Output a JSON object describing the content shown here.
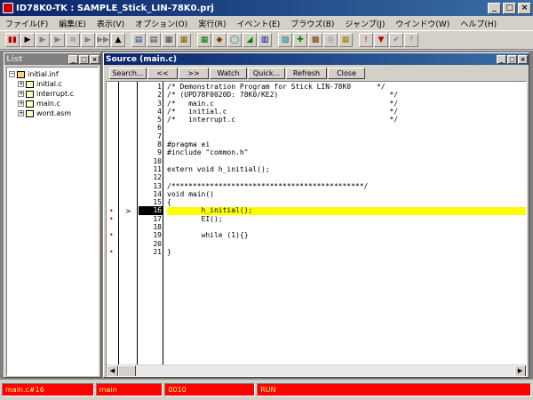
{
  "window": {
    "title": "ID78K0-TK : SAMPLE_Stick_LIN-78K0.prj"
  },
  "menu": [
    "ファイル(F)",
    "編集(E)",
    "表示(V)",
    "オプション(O)",
    "実行(R)",
    "イベント(E)",
    "ブラウズ(B)",
    "ジャンプ(J)",
    "ウインドウ(W)",
    "ヘルプ(H)"
  ],
  "toolbar_icons": [
    {
      "name": "stop-icon",
      "glyph": "▮▮",
      "color": "#c00000"
    },
    {
      "name": "run-icon",
      "glyph": "▶",
      "color": "#000"
    },
    {
      "name": "go-icon",
      "glyph": "▶",
      "color": "#808080"
    },
    {
      "name": "go-restart-icon",
      "glyph": "▶",
      "color": "#808080"
    },
    {
      "name": "step-in-icon",
      "glyph": "≡",
      "color": "#808080"
    },
    {
      "name": "step-over-icon",
      "glyph": "▶",
      "color": "#808080"
    },
    {
      "name": "return-icon",
      "glyph": "▶▶",
      "color": "#808080"
    },
    {
      "name": "eject-icon",
      "glyph": "▲",
      "color": "#000"
    },
    {
      "name": "source-icon",
      "glyph": "▤",
      "color": "#204080"
    },
    {
      "name": "assemble-icon",
      "glyph": "▤",
      "color": "#404040"
    },
    {
      "name": "memory-icon",
      "glyph": "▦",
      "color": "#404040"
    },
    {
      "name": "register-icon",
      "glyph": "▦",
      "color": "#806000"
    },
    {
      "name": "sfr-icon",
      "glyph": "▦",
      "color": "#008000"
    },
    {
      "name": "local-var-icon",
      "glyph": "◆",
      "color": "#804000"
    },
    {
      "name": "watch-icon",
      "glyph": "◯",
      "color": "#008080"
    },
    {
      "name": "quick-watch-icon",
      "glyph": "◢",
      "color": "#008000"
    },
    {
      "name": "stack-icon",
      "glyph": "▥",
      "color": "#0000a0"
    },
    {
      "name": "trace-icon",
      "glyph": "▧",
      "color": "#008080"
    },
    {
      "name": "event-icon",
      "glyph": "✚",
      "color": "#008000"
    },
    {
      "name": "breakpoint-icon",
      "glyph": "▩",
      "color": "#804000"
    },
    {
      "name": "timer-icon",
      "glyph": "◎",
      "color": "#808080"
    },
    {
      "name": "console-icon",
      "glyph": "▦",
      "color": "#a08000"
    },
    {
      "name": "alert-icon",
      "glyph": "!",
      "color": "#c00000"
    },
    {
      "name": "down-triangle-icon",
      "glyph": "▼",
      "color": "#c00000"
    },
    {
      "name": "check-icon",
      "glyph": "✔",
      "color": "#808080"
    },
    {
      "name": "help-icon",
      "glyph": "?",
      "color": "#808080"
    }
  ],
  "list_window": {
    "title": "List",
    "items": [
      {
        "label": "initial.inf",
        "indent": 0,
        "expander": "−",
        "kind": "ws"
      },
      {
        "label": "initial.c",
        "indent": 1,
        "expander": "+",
        "kind": "file"
      },
      {
        "label": "interrupt.c",
        "indent": 1,
        "expander": "+",
        "kind": "file"
      },
      {
        "label": "main.c",
        "indent": 1,
        "expander": "+",
        "kind": "file"
      },
      {
        "label": "word.asm",
        "indent": 1,
        "expander": "+",
        "kind": "file"
      }
    ]
  },
  "source_window": {
    "title": "Source (main.c)",
    "buttons": [
      "Search...",
      "<<",
      ">>",
      "Watch",
      "Quick...",
      "Refresh",
      "Close"
    ],
    "current_line": 16,
    "breakpoint_lines": [
      16,
      17,
      19,
      21
    ],
    "lines": [
      {
        "n": "1",
        "text": "/* Demonstration Program for Stick LIN-78K0      */"
      },
      {
        "n": "2",
        "text": "/* (UPD78F0020D: 78K0/KE2)                          */"
      },
      {
        "n": "3",
        "text": "/*   main.c                                         */"
      },
      {
        "n": "4",
        "text": "/*   initial.c                                      */"
      },
      {
        "n": "5",
        "text": "/*   interrupt.c                                    */"
      },
      {
        "n": "6",
        "text": ""
      },
      {
        "n": "7",
        "text": ""
      },
      {
        "n": "8",
        "text": "#pragma ei"
      },
      {
        "n": "9",
        "text": "#include \"common.h\""
      },
      {
        "n": "10",
        "text": ""
      },
      {
        "n": "11",
        "text": "extern void h_initial();"
      },
      {
        "n": "12",
        "text": ""
      },
      {
        "n": "13",
        "text": "/*********************************************/"
      },
      {
        "n": "14",
        "text": "void main()"
      },
      {
        "n": "15",
        "text": "{"
      },
      {
        "n": "16",
        "text": "        h_initial();"
      },
      {
        "n": "17",
        "text": "        EI();"
      },
      {
        "n": "18",
        "text": ""
      },
      {
        "n": "19",
        "text": "        while (1){}"
      },
      {
        "n": "20",
        "text": ""
      },
      {
        "n": "21",
        "text": "}"
      }
    ]
  },
  "status_bar": [
    "main.c#16",
    "main",
    "0010",
    "RUN"
  ]
}
